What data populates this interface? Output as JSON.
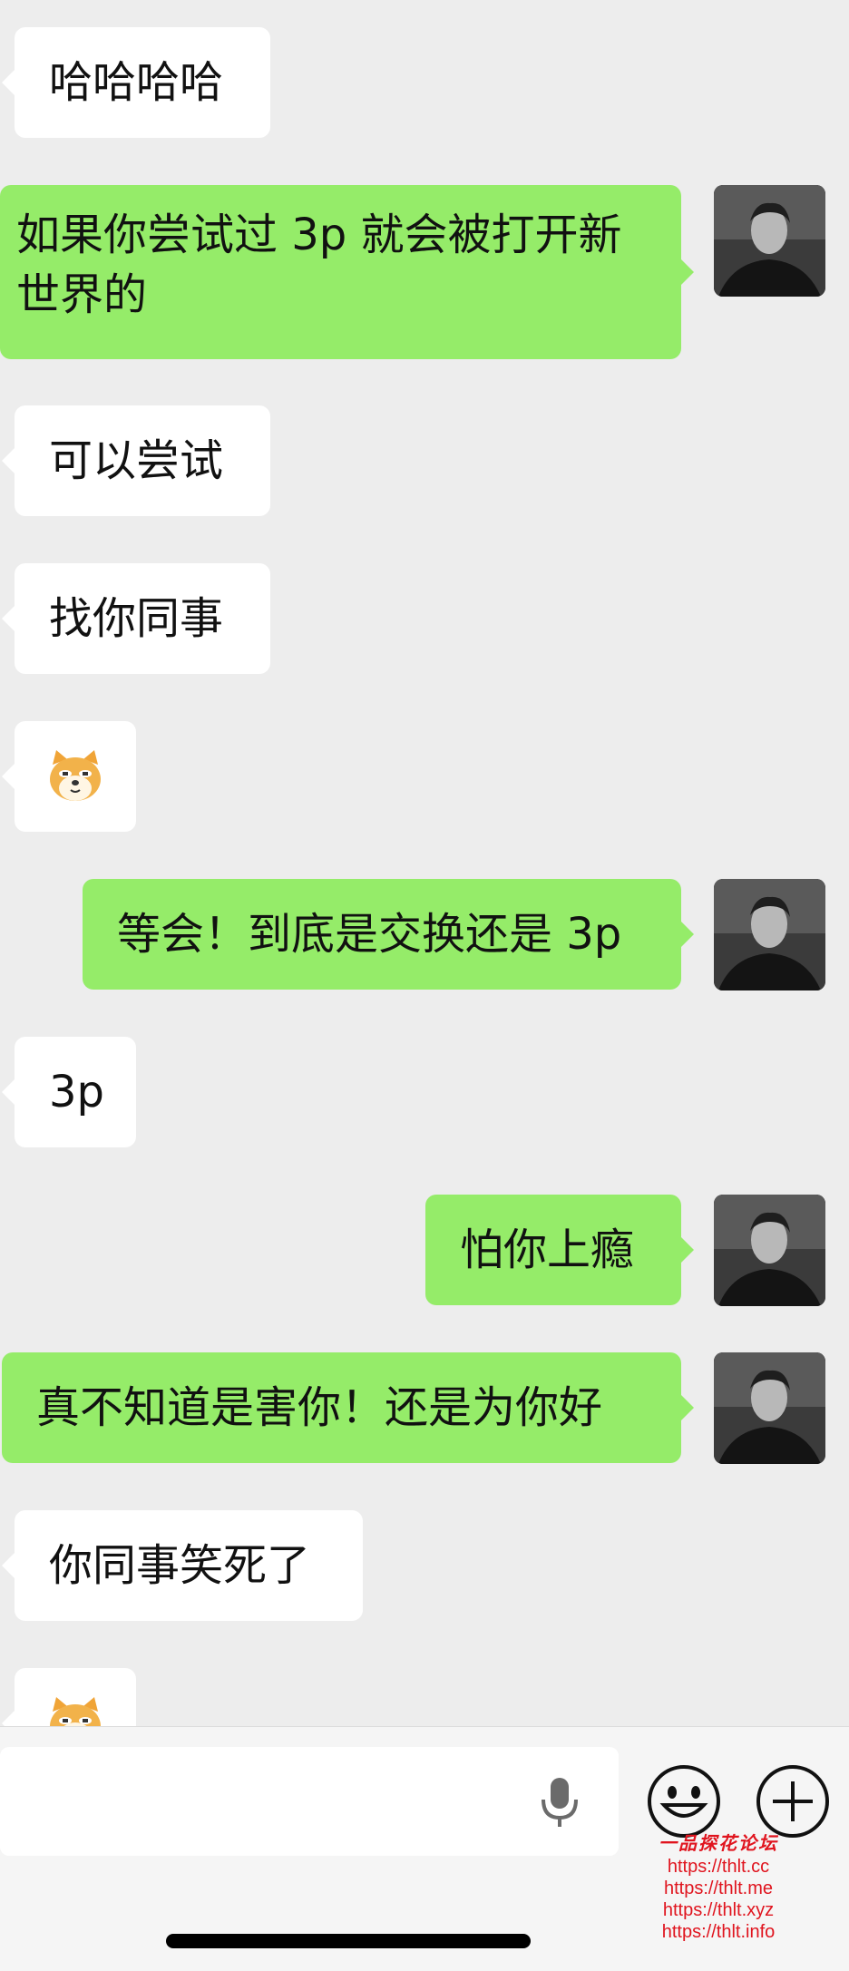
{
  "messages": [
    {
      "side": "in",
      "kind": "text",
      "text": "哈哈哈哈"
    },
    {
      "side": "out",
      "kind": "text",
      "text": "如果你尝试过 3p 就会被打开新世界的"
    },
    {
      "side": "in",
      "kind": "text",
      "text": "可以尝试"
    },
    {
      "side": "in",
      "kind": "text",
      "text": "找你同事"
    },
    {
      "side": "in",
      "kind": "emoji",
      "emoji": "doge-face-sticker"
    },
    {
      "side": "out",
      "kind": "text",
      "text": "等会！到底是交换还是 3p"
    },
    {
      "side": "in",
      "kind": "text",
      "text": "3p"
    },
    {
      "side": "out",
      "kind": "text",
      "text": "怕你上瘾"
    },
    {
      "side": "out",
      "kind": "text",
      "text": "真不知道是害你！还是为你好"
    },
    {
      "side": "in",
      "kind": "text",
      "text": "你同事笑死了"
    },
    {
      "side": "in",
      "kind": "emoji",
      "emoji": "doge-face-sticker"
    }
  ],
  "input_bar": {
    "placeholder": "",
    "icons": [
      "microphone-icon",
      "emoji-face-icon",
      "plus-icon"
    ]
  },
  "watermark": {
    "title": "一品探花论坛",
    "links": [
      "https://thlt.cc",
      "https://thlt.me",
      "https://thlt.xyz",
      "https://thlt.info"
    ]
  },
  "colors": {
    "chat_background": "#ededed",
    "outgoing_bubble": "#95ec69",
    "incoming_bubble": "#ffffff",
    "watermark": "#e0141e"
  }
}
